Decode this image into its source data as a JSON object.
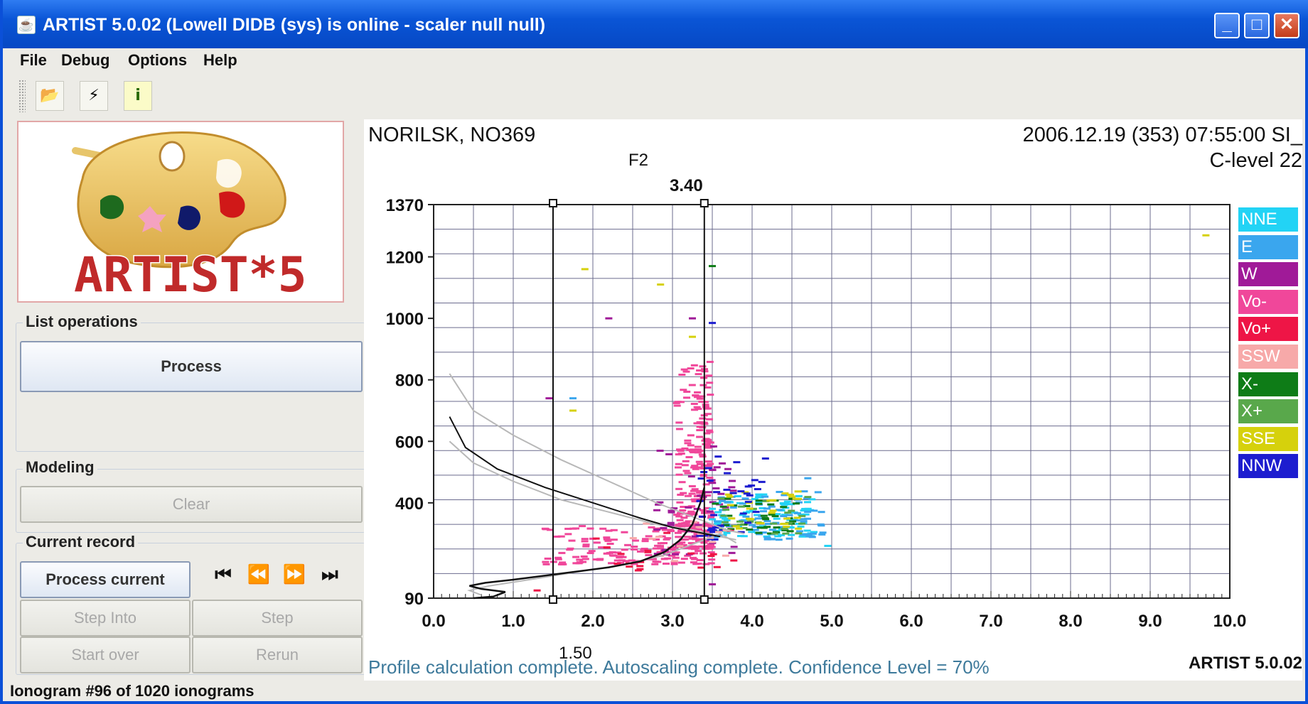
{
  "window": {
    "title": "ARTIST  5.0.02 (Lowell DIDB (sys) is online - scaler null null)",
    "minimize_icon": "minimize-icon",
    "maximize_icon": "maximize-icon",
    "close_icon": "close-icon"
  },
  "menu": [
    "File",
    "Debug",
    "Options",
    "Help"
  ],
  "toolbar": {
    "open": {
      "icon": "open-folder-icon",
      "glyph": "📂"
    },
    "run": {
      "icon": "lightning-icon",
      "glyph": "⚡"
    },
    "info": {
      "icon": "info-icon",
      "glyph": "i"
    }
  },
  "logo": {
    "text": "ARTIST*5"
  },
  "list_operations": {
    "label": "List operations",
    "process_button": "Process"
  },
  "modeling": {
    "label": "Modeling",
    "clear_button": "Clear"
  },
  "current_record": {
    "label": "Current record",
    "process_current_button": "Process current",
    "step_into_button": "Step Into",
    "step_button": "Step",
    "start_over_button": "Start over",
    "rerun_button": "Rerun",
    "nav": [
      {
        "icon": "first-record-icon",
        "glyph": "⏮"
      },
      {
        "icon": "previous-record-icon",
        "glyph": "⏪"
      },
      {
        "icon": "next-record-icon",
        "glyph": "⏩"
      },
      {
        "icon": "last-record-icon",
        "glyph": "⏭"
      }
    ]
  },
  "status_bar": "Ionogram #96 of 1020 ionograms",
  "ionogram": {
    "station": "NORILSK, NO369",
    "datetime": "2006.12.19 (353) 07:55:00 SI_",
    "clevel": "C-level 22",
    "layer": "F2",
    "marker_top": "3.40",
    "marker_bottom": "1.50",
    "message": "Profile calculation complete. Autoscaling  complete. Confidence Level = 70%",
    "version": "ARTIST 5.0.02"
  },
  "chart_data": {
    "type": "scatter",
    "x_ticks": [
      "0.0",
      "1.0",
      "2.0",
      "3.0",
      "4.0",
      "5.0",
      "6.0",
      "7.0",
      "8.0",
      "9.0",
      "10.0"
    ],
    "y_ticks": [
      {
        "value": 1370,
        "label": "1370"
      },
      {
        "value": 1200,
        "label": "1200"
      },
      {
        "value": 1000,
        "label": "1000"
      },
      {
        "value": 800,
        "label": "800"
      },
      {
        "value": 600,
        "label": "600"
      },
      {
        "value": 400,
        "label": "400"
      },
      {
        "value": 90,
        "label": "90"
      }
    ],
    "xlim": [
      0,
      10
    ],
    "ylim": [
      90,
      1370
    ],
    "grid": true,
    "cursor_lines_x": [
      1.5,
      3.4
    ],
    "legend": [
      {
        "name": "NNE",
        "color": "#22d3f5"
      },
      {
        "name": "E",
        "color": "#3aa6ee"
      },
      {
        "name": "W",
        "color": "#a01a98"
      },
      {
        "name": "Vo-",
        "color": "#f0479a"
      },
      {
        "name": "Vo+",
        "color": "#ee1546"
      },
      {
        "name": "SSW",
        "color": "#f7a9a9"
      },
      {
        "name": "X-",
        "color": "#0e7c17"
      },
      {
        "name": "X+",
        "color": "#59a84b"
      },
      {
        "name": "SSE",
        "color": "#d6d10c"
      },
      {
        "name": "NNW",
        "color": "#1d1dcf"
      }
    ],
    "clusters": [
      {
        "series": "Vo-",
        "x_range": [
          1.4,
          3.5
        ],
        "y_range": [
          200,
          330
        ],
        "count": 170
      },
      {
        "series": "Vo-",
        "x_range": [
          3.05,
          3.5
        ],
        "y_range": [
          250,
          860
        ],
        "count": 230
      },
      {
        "series": "W",
        "x_range": [
          2.8,
          3.8
        ],
        "y_range": [
          230,
          600
        ],
        "count": 50
      },
      {
        "series": "NNE",
        "x_range": [
          3.5,
          4.8
        ],
        "y_range": [
          290,
          430
        ],
        "count": 90
      },
      {
        "series": "E",
        "x_range": [
          3.5,
          4.9
        ],
        "y_range": [
          280,
          440
        ],
        "count": 70
      },
      {
        "series": "X-",
        "x_range": [
          3.5,
          4.6
        ],
        "y_range": [
          300,
          420
        ],
        "count": 35
      },
      {
        "series": "X+",
        "x_range": [
          3.6,
          4.7
        ],
        "y_range": [
          300,
          420
        ],
        "count": 25
      },
      {
        "series": "SSE",
        "x_range": [
          3.6,
          4.6
        ],
        "y_range": [
          310,
          440
        ],
        "count": 30
      },
      {
        "series": "NNW",
        "x_range": [
          3.3,
          4.2
        ],
        "y_range": [
          280,
          560
        ],
        "count": 40
      },
      {
        "series": "Vo+",
        "x_range": [
          2.0,
          3.8
        ],
        "y_range": [
          180,
          330
        ],
        "count": 20
      },
      {
        "series": "SSW",
        "x_range": [
          2.4,
          3.7
        ],
        "y_range": [
          200,
          340
        ],
        "count": 15
      }
    ],
    "isolated_points": [
      {
        "series": "SSE",
        "x": 9.7,
        "y": 1270
      },
      {
        "series": "SSE",
        "x": 1.9,
        "y": 1160
      },
      {
        "series": "SSE",
        "x": 2.85,
        "y": 1110
      },
      {
        "series": "X-",
        "x": 3.5,
        "y": 1170
      },
      {
        "series": "W",
        "x": 2.2,
        "y": 1000
      },
      {
        "series": "W",
        "x": 3.25,
        "y": 1000
      },
      {
        "series": "NNW",
        "x": 3.5,
        "y": 985
      },
      {
        "series": "SSE",
        "x": 3.25,
        "y": 940
      },
      {
        "series": "W",
        "x": 1.45,
        "y": 740
      },
      {
        "series": "E",
        "x": 1.75,
        "y": 740
      },
      {
        "series": "SSE",
        "x": 1.75,
        "y": 700
      },
      {
        "series": "E",
        "x": 4.7,
        "y": 480
      },
      {
        "series": "NNE",
        "x": 4.95,
        "y": 260
      },
      {
        "series": "Vo+",
        "x": 1.3,
        "y": 115
      },
      {
        "series": "W",
        "x": 3.5,
        "y": 135
      }
    ],
    "profile_curve": [
      [
        0.5,
        90
      ],
      [
        0.75,
        95
      ],
      [
        0.9,
        110
      ],
      [
        0.6,
        120
      ],
      [
        0.45,
        130
      ],
      [
        0.65,
        140
      ],
      [
        1.0,
        150
      ],
      [
        1.6,
        170
      ],
      [
        2.2,
        190
      ],
      [
        2.6,
        210
      ],
      [
        2.9,
        240
      ],
      [
        3.1,
        280
      ],
      [
        3.25,
        330
      ],
      [
        3.35,
        400
      ],
      [
        3.4,
        450
      ]
    ],
    "model_curve": [
      [
        0.2,
        680
      ],
      [
        0.4,
        580
      ],
      [
        0.8,
        510
      ],
      [
        1.4,
        450
      ],
      [
        2.0,
        400
      ],
      [
        2.6,
        350
      ],
      [
        3.0,
        320
      ],
      [
        3.4,
        300
      ],
      [
        3.6,
        290
      ]
    ],
    "model_upper": [
      [
        0.2,
        820
      ],
      [
        0.5,
        700
      ],
      [
        1.0,
        620
      ],
      [
        1.6,
        540
      ],
      [
        2.2,
        470
      ],
      [
        2.8,
        400
      ],
      [
        3.3,
        350
      ],
      [
        3.7,
        310
      ],
      [
        3.9,
        300
      ]
    ],
    "model_lower": [
      [
        0.2,
        600
      ],
      [
        0.5,
        530
      ],
      [
        1.0,
        470
      ],
      [
        1.6,
        410
      ],
      [
        2.2,
        370
      ],
      [
        2.8,
        330
      ],
      [
        3.3,
        310
      ],
      [
        3.6,
        290
      ],
      [
        3.8,
        280
      ]
    ],
    "profile_lower": [
      [
        0.6,
        100
      ],
      [
        0.45,
        115
      ],
      [
        0.7,
        130
      ],
      [
        1.2,
        150
      ],
      [
        1.8,
        175
      ],
      [
        2.4,
        200
      ],
      [
        2.9,
        230
      ],
      [
        3.3,
        270
      ],
      [
        3.6,
        300
      ],
      [
        3.8,
        270
      ]
    ]
  }
}
